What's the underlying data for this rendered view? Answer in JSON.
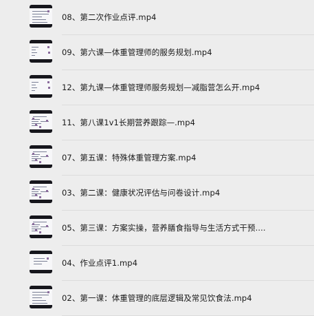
{
  "files": [
    {
      "name": "08、第二次作业点评.mp4",
      "thumb_variant": 0
    },
    {
      "name": "09、第六课—体重管理师的服务规划.mp4",
      "thumb_variant": 1
    },
    {
      "name": "12、第九课—体重管理师服务规划—减脂营怎么开.mp4",
      "thumb_variant": 1
    },
    {
      "name": "11、第八课1v1长期营养跟踪—.mp4",
      "thumb_variant": 2
    },
    {
      "name": "07、第五课：特殊体重管理方案.mp4",
      "thumb_variant": 2
    },
    {
      "name": "03、第二课：健康状况评估与问卷设计.mp4",
      "thumb_variant": 2
    },
    {
      "name": "05、第三课：方案实操，营养膳食指导与生活方式干预....",
      "thumb_variant": 2
    },
    {
      "name": "04、作业点评1.mp4",
      "thumb_variant": 3
    },
    {
      "name": "02、第一课：体重管理的底层逻辑及常见饮食法.mp4",
      "thumb_variant": 0
    }
  ]
}
